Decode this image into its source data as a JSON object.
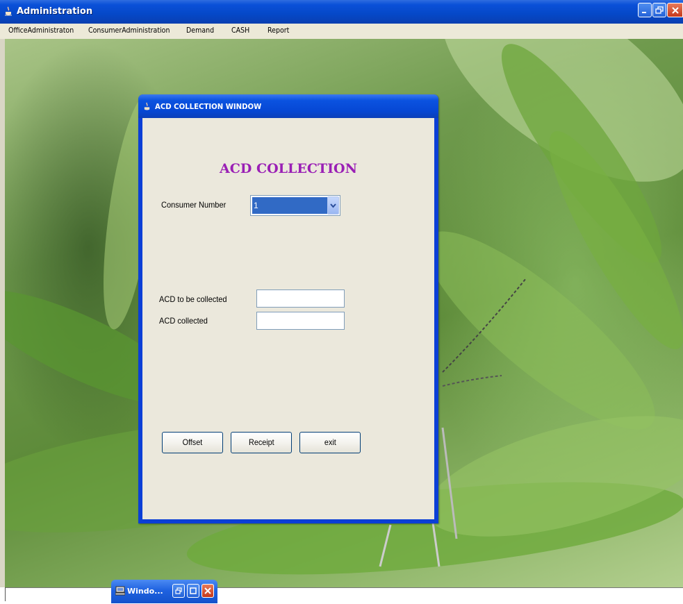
{
  "main_window": {
    "title": "Administration",
    "menu": [
      "OfficeAdministraton",
      "ConsumerAdministration",
      "Demand",
      "CASH",
      "Report"
    ]
  },
  "dialog": {
    "title": "ACD COLLECTION WINDOW",
    "heading": "ACD COLLECTION",
    "consumer_number_label": "Consumer Number",
    "consumer_number_value": "1",
    "acd_to_be_collected_label": "ACD to be collected",
    "acd_to_be_collected_value": "",
    "acd_collected_label": "ACD  collected",
    "acd_collected_value": "",
    "buttons": {
      "offset": "Offset",
      "receipt": "Receipt",
      "exit": "exit"
    }
  },
  "minimized_window": {
    "title": "Windo..."
  },
  "colors": {
    "heading": "#9a1fb5",
    "titlebar": "#0a50d8",
    "dialog_body": "#ebe8dc",
    "selection": "#316ac5"
  },
  "icons": [
    "java-icon",
    "minimize-icon",
    "restore-icon",
    "close-icon",
    "dropdown-arrow-icon",
    "computer-icon",
    "maximize-icon"
  ]
}
